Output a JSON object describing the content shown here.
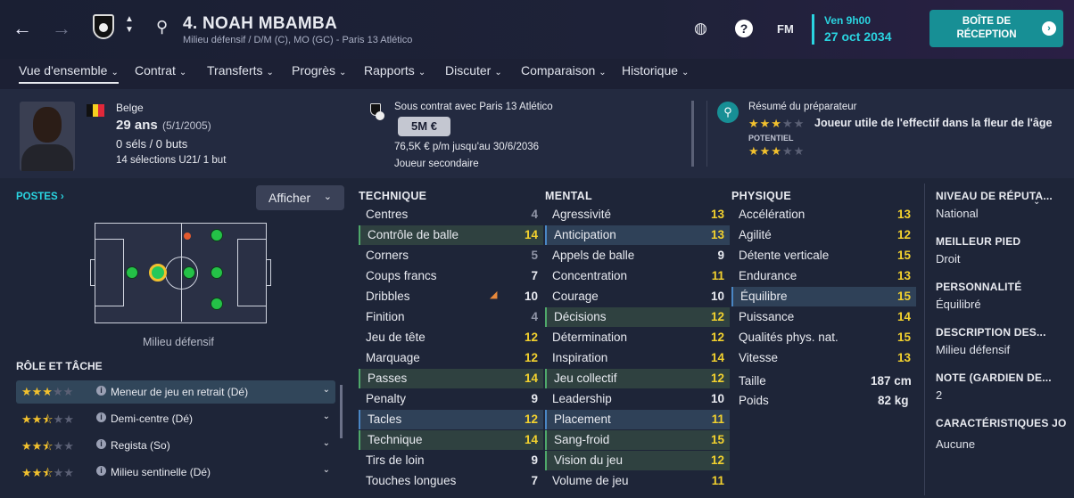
{
  "header": {
    "player_title": "4. NOAH MBAMBA",
    "player_subtitle": "Milieu défensif / D/M (C), MO (GC) - Paris 13 Atlético",
    "date_day": "Ven 9h00",
    "date_full": "27 oct 2034",
    "inbox_label": "BOÎTE DE RÉCEPTION",
    "fm_label": "FM",
    "help_label": "?"
  },
  "tabs": [
    {
      "label": "Vue d'ensemble"
    },
    {
      "label": "Contrat"
    },
    {
      "label": "Transferts"
    },
    {
      "label": "Progrès"
    },
    {
      "label": "Rapports"
    },
    {
      "label": "Discuter"
    },
    {
      "label": "Comparaison"
    },
    {
      "label": "Historique"
    }
  ],
  "bio": {
    "nationality": "Belge",
    "age": "29 ans",
    "dob": "(5/1/2005)",
    "caps": "0 séls / 0 buts",
    "u21": "14 sélections U21/ 1 but"
  },
  "contract": {
    "club_line": "Sous contrat avec Paris 13 Atlético",
    "value": "5M €",
    "wage": "76,5K € p/m jusqu'au 30/6/2036",
    "status": "Joueur secondaire"
  },
  "coach": {
    "title": "Résumé du préparateur",
    "summary": "Joueur utile de l'effectif dans la fleur de l'âge",
    "potential_label": "POTENTIEL",
    "current_stars": 3,
    "potential_stars": 3
  },
  "positions": {
    "label": "POSTES",
    "show_button": "Afficher",
    "position_name": "Milieu défensif"
  },
  "roles": {
    "title": "RÔLE ET TÂCHE",
    "items": [
      {
        "name": "Meneur de jeu en retrait (Dé)",
        "stars": 3
      },
      {
        "name": "Demi-centre (Dé)",
        "stars": 2.5
      },
      {
        "name": "Regista (So)",
        "stars": 2.5
      },
      {
        "name": "Milieu sentinelle (Dé)",
        "stars": 2.5
      }
    ]
  },
  "technique": {
    "title": "TECHNIQUE",
    "items": [
      {
        "label": "Centres",
        "value": "4",
        "hl": ""
      },
      {
        "label": "Contrôle de balle",
        "value": "14",
        "hl": "green"
      },
      {
        "label": "Corners",
        "value": "5",
        "hl": ""
      },
      {
        "label": "Coups francs",
        "value": "7",
        "hl": ""
      },
      {
        "label": "Dribbles",
        "value": "10",
        "hl": ""
      },
      {
        "label": "Finition",
        "value": "4",
        "hl": ""
      },
      {
        "label": "Jeu de tête",
        "value": "12",
        "hl": ""
      },
      {
        "label": "Marquage",
        "value": "12",
        "hl": ""
      },
      {
        "label": "Passes",
        "value": "14",
        "hl": "green"
      },
      {
        "label": "Penalty",
        "value": "9",
        "hl": ""
      },
      {
        "label": "Tacles",
        "value": "12",
        "hl": "blue"
      },
      {
        "label": "Technique",
        "value": "14",
        "hl": "green"
      },
      {
        "label": "Tirs de loin",
        "value": "9",
        "hl": ""
      },
      {
        "label": "Touches longues",
        "value": "7",
        "hl": ""
      }
    ]
  },
  "mental": {
    "title": "MENTAL",
    "items": [
      {
        "label": "Agressivité",
        "value": "13",
        "hl": ""
      },
      {
        "label": "Anticipation",
        "value": "13",
        "hl": "blue"
      },
      {
        "label": "Appels de balle",
        "value": "9",
        "hl": ""
      },
      {
        "label": "Concentration",
        "value": "11",
        "hl": ""
      },
      {
        "label": "Courage",
        "value": "10",
        "hl": ""
      },
      {
        "label": "Décisions",
        "value": "12",
        "hl": "green"
      },
      {
        "label": "Détermination",
        "value": "12",
        "hl": ""
      },
      {
        "label": "Inspiration",
        "value": "14",
        "hl": ""
      },
      {
        "label": "Jeu collectif",
        "value": "12",
        "hl": "green"
      },
      {
        "label": "Leadership",
        "value": "10",
        "hl": ""
      },
      {
        "label": "Placement",
        "value": "11",
        "hl": "blue"
      },
      {
        "label": "Sang-froid",
        "value": "15",
        "hl": "green"
      },
      {
        "label": "Vision du jeu",
        "value": "12",
        "hl": "green"
      },
      {
        "label": "Volume de jeu",
        "value": "11",
        "hl": ""
      }
    ]
  },
  "physique": {
    "title": "PHYSIQUE",
    "items": [
      {
        "label": "Accélération",
        "value": "13",
        "hl": ""
      },
      {
        "label": "Agilité",
        "value": "12",
        "hl": ""
      },
      {
        "label": "Détente verticale",
        "value": "15",
        "hl": ""
      },
      {
        "label": "Endurance",
        "value": "13",
        "hl": ""
      },
      {
        "label": "Équilibre",
        "value": "15",
        "hl": "blue"
      },
      {
        "label": "Puissance",
        "value": "14",
        "hl": ""
      },
      {
        "label": "Qualités phys. nat.",
        "value": "15",
        "hl": ""
      },
      {
        "label": "Vitesse",
        "value": "13",
        "hl": ""
      }
    ],
    "height_label": "Taille",
    "height": "187 cm",
    "weight_label": "Poids",
    "weight": "82 kg"
  },
  "details": [
    {
      "label": "NIVEAU DE RÉPUTA...",
      "value": "National"
    },
    {
      "label": "MEILLEUR PIED",
      "value": "Droit"
    },
    {
      "label": "PERSONNALITÉ",
      "value": "Équilibré"
    },
    {
      "label": "DESCRIPTION DES...",
      "value": "Milieu défensif"
    },
    {
      "label": "NOTE (GARDIEN DE...",
      "value": "2"
    },
    {
      "label": "CARACTÉRISTIQUES JO",
      "value": "Aucune"
    }
  ]
}
